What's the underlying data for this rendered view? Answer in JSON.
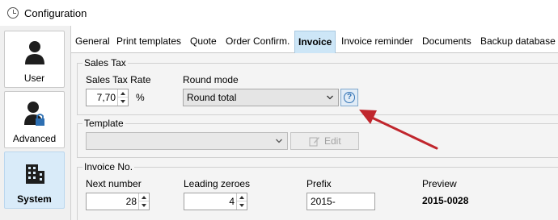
{
  "window": {
    "title": "Configuration"
  },
  "sidebar": {
    "items": [
      {
        "label": "User",
        "icon": "user-icon",
        "active": false
      },
      {
        "label": "Advanced",
        "icon": "user-lock-icon",
        "active": false
      },
      {
        "label": "System",
        "icon": "building-icon",
        "active": true
      }
    ]
  },
  "tabs": [
    {
      "label": "General"
    },
    {
      "label": "Print templates"
    },
    {
      "label": "Quote"
    },
    {
      "label": "Order Confirm."
    },
    {
      "label": "Invoice",
      "active": true
    },
    {
      "label": "Invoice reminder"
    },
    {
      "label": "Documents"
    },
    {
      "label": "Backup database"
    }
  ],
  "sales_tax": {
    "group_title": "Sales Tax",
    "rate_label": "Sales Tax Rate",
    "rate_value": "7,70",
    "rate_unit": "%",
    "round_mode_label": "Round mode",
    "round_mode_value": "Round total"
  },
  "template": {
    "group_title": "Template",
    "selected_value": "",
    "edit_label": "Edit"
  },
  "invoice_no": {
    "group_title": "Invoice No.",
    "next_number_label": "Next number",
    "next_number_value": "28",
    "leading_zeroes_label": "Leading zeroes",
    "leading_zeroes_value": "4",
    "prefix_label": "Prefix",
    "prefix_value": "2015-",
    "preview_label": "Preview",
    "preview_value": "2015-0028"
  },
  "colors": {
    "accent": "#cde6f7",
    "annotation_arrow": "#c0262d",
    "help_icon": "#2d6fb2"
  }
}
